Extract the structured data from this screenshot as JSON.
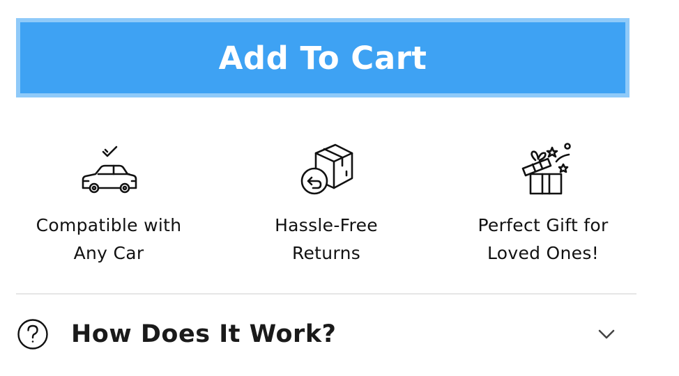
{
  "cart_button": {
    "label": "Add To Cart"
  },
  "features": [
    {
      "icon": "car-check-icon",
      "line1": "Compatible with",
      "line2": "Any Car"
    },
    {
      "icon": "box-return-icon",
      "line1": "Hassle-Free",
      "line2": "Returns"
    },
    {
      "icon": "gift-box-icon",
      "line1": "Perfect Gift for",
      "line2": "Loved Ones!"
    }
  ],
  "accordion": {
    "icon": "question-circle-icon",
    "title": "How Does It Work?",
    "toggle_icon": "chevron-down-icon"
  },
  "colors": {
    "button_bg": "#3ea2f3",
    "button_border": "#8fcaf9",
    "text": "#111111",
    "divider": "#e6e6e6"
  }
}
